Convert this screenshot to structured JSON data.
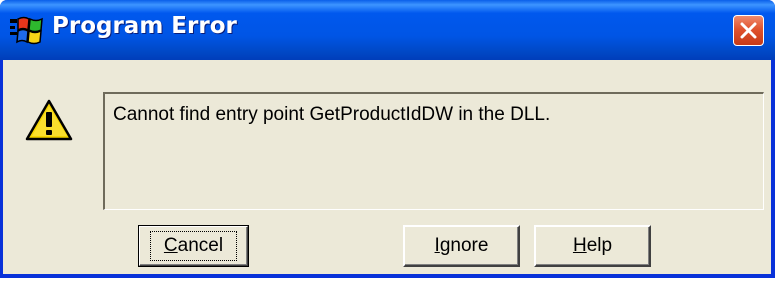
{
  "window": {
    "title": "Program Error",
    "message": "Cannot find entry point GetProductIdDW in the DLL.",
    "icons": {
      "app": "windows-flag-icon",
      "warning": "warning-icon",
      "close": "close-icon"
    }
  },
  "buttons": {
    "cancel": {
      "mnemonic": "C",
      "rest": "ancel"
    },
    "ignore": {
      "mnemonic": "I",
      "rest": "gnore"
    },
    "help": {
      "mnemonic": "H",
      "rest": "elp"
    }
  },
  "colors": {
    "titlebar": "#0055e5",
    "dialog_bg": "#ece9d8",
    "close_button": "#e0532e",
    "warning_yellow": "#f5d400"
  }
}
